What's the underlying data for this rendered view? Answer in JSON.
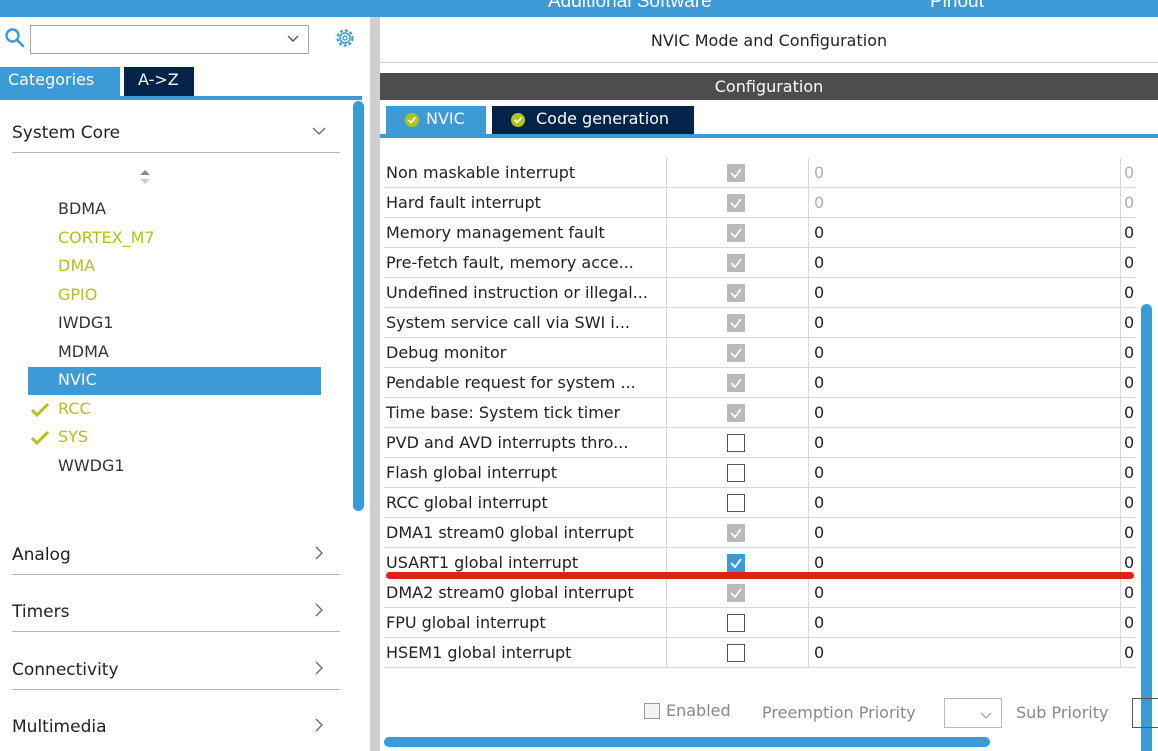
{
  "topbar": {
    "left_text": "Additional Software",
    "right_text": "Pinout"
  },
  "left_panel": {
    "search": {
      "value": "",
      "placeholder": ""
    },
    "tabs": {
      "categories": "Categories",
      "az": "A->Z"
    },
    "sections": {
      "system_core": "System Core",
      "analog": "Analog",
      "timers": "Timers",
      "connectivity": "Connectivity",
      "multimedia": "Multimedia"
    },
    "items": [
      {
        "label": "BDMA",
        "state": "normal"
      },
      {
        "label": "CORTEX_M7",
        "state": "configured"
      },
      {
        "label": "DMA",
        "state": "configured"
      },
      {
        "label": "GPIO",
        "state": "configured"
      },
      {
        "label": "IWDG1",
        "state": "normal"
      },
      {
        "label": "MDMA",
        "state": "normal"
      },
      {
        "label": "NVIC",
        "state": "selected"
      },
      {
        "label": "RCC",
        "state": "checked"
      },
      {
        "label": "SYS",
        "state": "checked"
      },
      {
        "label": "WWDG1",
        "state": "normal"
      }
    ]
  },
  "right_panel": {
    "title": "NVIC Mode and Configuration",
    "config_label": "Configuration",
    "tabs": {
      "nvic": "NVIC",
      "code_generation": "Code generation"
    },
    "rows": [
      {
        "name": "Non maskable interrupt",
        "enabled": "locked",
        "preemption": "0",
        "sub": "0",
        "dim": true
      },
      {
        "name": "Hard fault interrupt",
        "enabled": "locked",
        "preemption": "0",
        "sub": "0",
        "dim": true
      },
      {
        "name": "Memory management fault",
        "enabled": "locked",
        "preemption": "0",
        "sub": "0",
        "dim": false
      },
      {
        "name": "Pre-fetch fault, memory acce...",
        "enabled": "locked",
        "preemption": "0",
        "sub": "0",
        "dim": false
      },
      {
        "name": "Undefined instruction or illegal...",
        "enabled": "locked",
        "preemption": "0",
        "sub": "0",
        "dim": false
      },
      {
        "name": "System service call via SWI i...",
        "enabled": "locked",
        "preemption": "0",
        "sub": "0",
        "dim": false
      },
      {
        "name": "Debug monitor",
        "enabled": "locked",
        "preemption": "0",
        "sub": "0",
        "dim": false
      },
      {
        "name": "Pendable request for system ...",
        "enabled": "locked",
        "preemption": "0",
        "sub": "0",
        "dim": false
      },
      {
        "name": "Time base: System tick timer",
        "enabled": "locked",
        "preemption": "0",
        "sub": "0",
        "dim": false
      },
      {
        "name": "PVD and AVD interrupts thro...",
        "enabled": "off",
        "preemption": "0",
        "sub": "0",
        "dim": false
      },
      {
        "name": "Flash global interrupt",
        "enabled": "off",
        "preemption": "0",
        "sub": "0",
        "dim": false
      },
      {
        "name": "RCC global interrupt",
        "enabled": "off",
        "preemption": "0",
        "sub": "0",
        "dim": false
      },
      {
        "name": "DMA1 stream0 global interrupt",
        "enabled": "locked",
        "preemption": "0",
        "sub": "0",
        "dim": false
      },
      {
        "name": "USART1 global interrupt",
        "enabled": "on",
        "preemption": "0",
        "sub": "0",
        "dim": false
      },
      {
        "name": "DMA2 stream0 global interrupt",
        "enabled": "locked",
        "preemption": "0",
        "sub": "0",
        "dim": false
      },
      {
        "name": "FPU global interrupt",
        "enabled": "off",
        "preemption": "0",
        "sub": "0",
        "dim": false
      },
      {
        "name": "HSEM1 global interrupt",
        "enabled": "off",
        "preemption": "0",
        "sub": "0",
        "dim": false
      }
    ],
    "bottom": {
      "enabled_label": "Enabled",
      "preemption_label": "Preemption Priority",
      "sub_label": "Sub Priority"
    }
  },
  "colors": {
    "accent": "#3c9ad6",
    "dark_tab": "#03234b",
    "configured": "#b2c416",
    "highlight": "#e0201b"
  }
}
